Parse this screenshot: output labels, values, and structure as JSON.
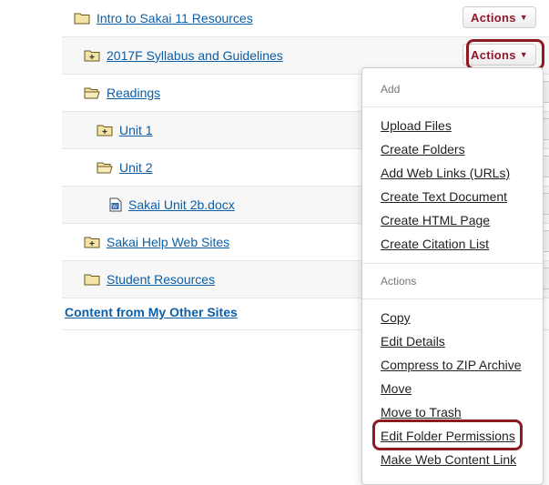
{
  "colors": {
    "link": "#0c5ea6",
    "actions_text": "#8b1a2a",
    "highlight": "#8a1c22",
    "folder_fill": "#f3e3a6"
  },
  "tree": {
    "items": [
      {
        "label": "Intro to Sakai 11 Resources",
        "icon": "folder-icon"
      },
      {
        "label": "2017F Syllabus and Guidelines",
        "icon": "folder-expand-icon"
      },
      {
        "label": "Readings",
        "icon": "folder-open-icon"
      },
      {
        "label": "Unit 1",
        "icon": "folder-expand-icon"
      },
      {
        "label": "Unit 2",
        "icon": "folder-open-icon"
      },
      {
        "label": "Sakai Unit 2b.docx",
        "icon": "word-document-icon"
      },
      {
        "label": "Sakai Help Web Sites",
        "icon": "folder-expand-icon"
      },
      {
        "label": "Student Resources",
        "icon": "folder-icon"
      }
    ],
    "actions_label": "Actions",
    "other_sites_label": "Content from My Other Sites"
  },
  "menu": {
    "add_header": "Add",
    "add_items": [
      "Upload Files",
      "Create Folders",
      "Add Web Links (URLs)",
      "Create Text Document",
      "Create HTML Page",
      "Create Citation List"
    ],
    "actions_header": "Actions",
    "action_items": [
      "Copy",
      "Edit Details",
      "Compress to ZIP Archive",
      "Move",
      "Move to Trash",
      "Edit Folder Permissions",
      "Make Web Content Link"
    ]
  }
}
